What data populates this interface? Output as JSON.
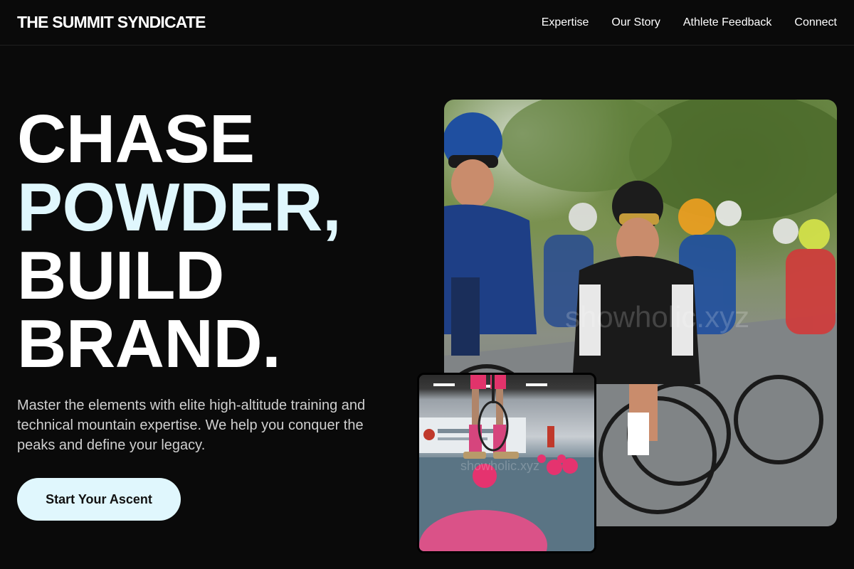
{
  "header": {
    "brand": "THE SUMMIT SYNDICATE",
    "nav": [
      {
        "label": "Expertise"
      },
      {
        "label": "Our Story"
      },
      {
        "label": "Athlete Feedback"
      },
      {
        "label": "Connect"
      }
    ]
  },
  "hero": {
    "title_lines": [
      "CHASE",
      "POWDER,",
      "BUILD",
      "BRAND."
    ],
    "subtitle": "Master the elements with elite high-altitude training and technical mountain expertise. We help you conquer the peaks and define your legacy.",
    "cta_label": "Start Your Ascent"
  },
  "images": {
    "main": "cycling-peloton-photo",
    "small": "tennis-balls-photo"
  },
  "colors": {
    "background": "#0a0a0a",
    "accent": "#e0f7fd",
    "text": "#ffffff",
    "muted": "#cfcfcf"
  }
}
